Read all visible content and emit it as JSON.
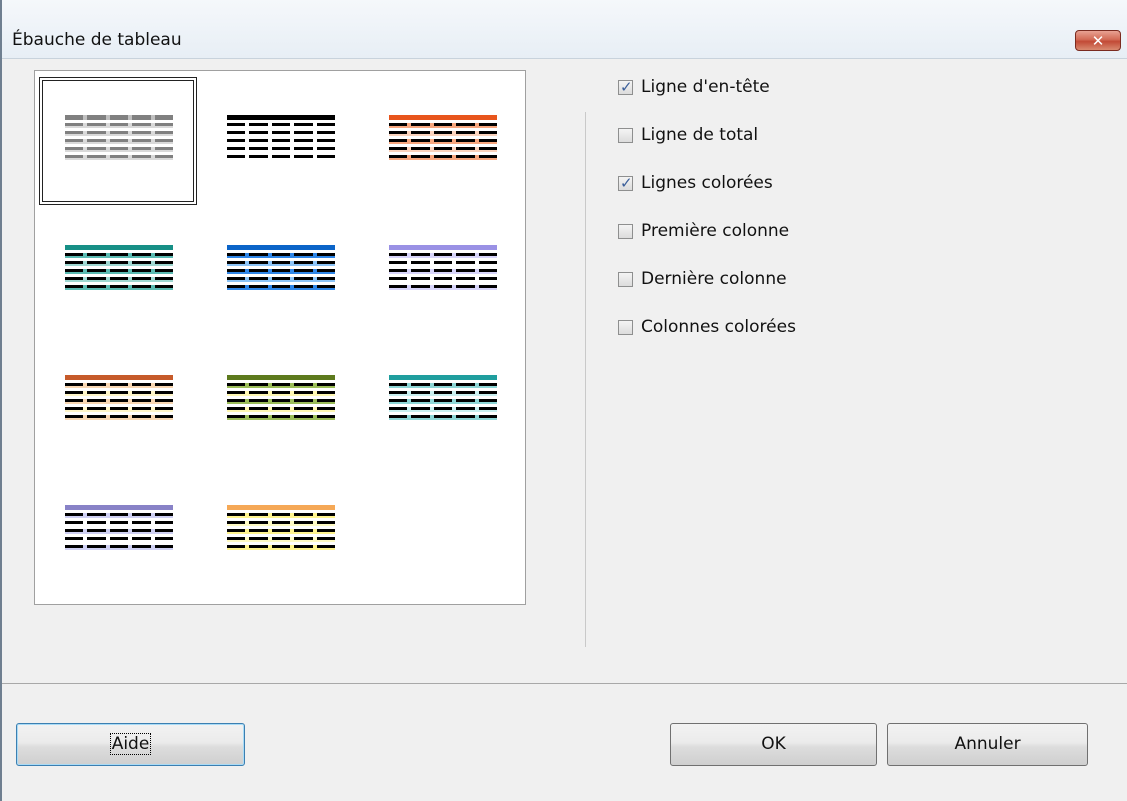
{
  "window": {
    "title": "Ébauche de tableau",
    "close_label": "✕"
  },
  "styles": [
    {
      "name": "default",
      "header": "#c0c0c0",
      "rows": [
        "#d9d9d9",
        "#d9d9d9",
        "#d9d9d9",
        "#d9d9d9",
        "#d9d9d9"
      ],
      "dash": "#808080",
      "selected": true
    },
    {
      "name": "black",
      "header": "#000000",
      "rows": [
        "#ffffff",
        "#ffffff",
        "#ffffff",
        "#ffffff",
        "#ffffff"
      ],
      "dash": "#000000",
      "selected": false
    },
    {
      "name": "orange",
      "header": "#e8551c",
      "rows": [
        "#f7a77f",
        "#fbd3bd",
        "#f7a77f",
        "#fbd3bd",
        "#f7a77f"
      ],
      "dash": "#000000",
      "selected": false
    },
    {
      "name": "teal",
      "header": "#168f86",
      "rows": [
        "#5bbab2",
        "#9fd8d2",
        "#5bbab2",
        "#9fd8d2",
        "#5bbab2"
      ],
      "dash": "#000000",
      "selected": false
    },
    {
      "name": "blue",
      "header": "#0b64c8",
      "rows": [
        "#2f86e7",
        "#8cc4f7",
        "#2f86e7",
        "#8cc4f7",
        "#2f86e7"
      ],
      "dash": "#000000",
      "selected": false
    },
    {
      "name": "lavender",
      "header": "#9a91e5",
      "rows": [
        "#d8d5fb",
        "#ffffff",
        "#d8d5fb",
        "#ffffff",
        "#d8d5fb"
      ],
      "dash": "#000000",
      "selected": false
    },
    {
      "name": "rust",
      "header": "#c65a2a",
      "rows": [
        "#f8d7b3",
        "#fff6c9",
        "#f8d7b3",
        "#fff6c9",
        "#f8d7b3"
      ],
      "dash": "#000000",
      "selected": false
    },
    {
      "name": "olive",
      "header": "#5d7a1d",
      "rows": [
        "#9cbd5a",
        "#fff8b3",
        "#9cbd5a",
        "#fff8b3",
        "#9cbd5a"
      ],
      "dash": "#000000",
      "selected": false
    },
    {
      "name": "cyan",
      "header": "#1f9e9e",
      "rows": [
        "#8ed6d6",
        "#c9f0f0",
        "#8ed6d6",
        "#c9f0f0",
        "#8ed6d6"
      ],
      "dash": "#000000",
      "selected": false
    },
    {
      "name": "slate",
      "header": "#8882c7",
      "rows": [
        "#cfd0f3",
        "#ffffff",
        "#cfd0f3",
        "#ffffff",
        "#cfd0f3"
      ],
      "dash": "#000000",
      "selected": false
    },
    {
      "name": "yellow",
      "header": "#f5a856",
      "rows": [
        "#fff48f",
        "#fffbc4",
        "#fff48f",
        "#fffbc4",
        "#fff48f"
      ],
      "dash": "#000000",
      "selected": false
    }
  ],
  "options": [
    {
      "label": "Ligne d'en-tête",
      "checked": true
    },
    {
      "label": "Ligne de total",
      "checked": false
    },
    {
      "label": "Lignes colorées",
      "checked": true
    },
    {
      "label": "Première colonne",
      "checked": false
    },
    {
      "label": "Dernière colonne",
      "checked": false
    },
    {
      "label": "Colonnes colorées",
      "checked": false
    }
  ],
  "buttons": {
    "help": "Aide",
    "ok": "OK",
    "cancel": "Annuler"
  },
  "check_glyph": "✓"
}
